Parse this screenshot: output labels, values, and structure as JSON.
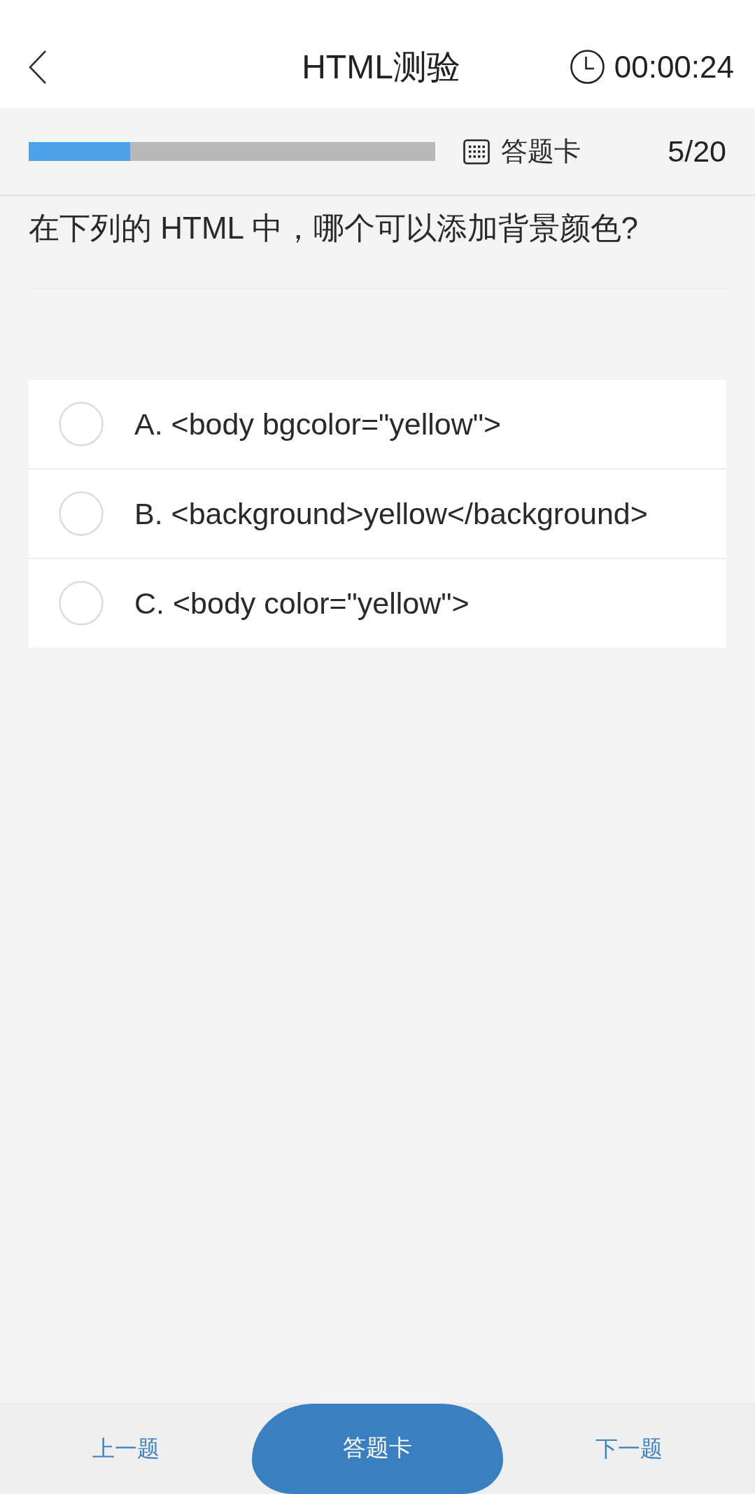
{
  "header": {
    "title": "HTML测验",
    "timer": "00:00:24"
  },
  "progress": {
    "level": 0.25,
    "answer_card_label": "答题卡",
    "counter": "5/20"
  },
  "question": {
    "text": "在下列的 HTML 中，哪个可以添加背景颜色?"
  },
  "options": [
    {
      "label": "A. <body bgcolor=\"yellow\">",
      "selected": false
    },
    {
      "label": "B. <background>yellow</background>",
      "selected": false
    },
    {
      "label": "C. <body color=\"yellow\">",
      "selected": false
    }
  ],
  "bottom_bar": {
    "buttons": [
      {
        "label": "上一题",
        "kind": "text"
      },
      {
        "label": "答题卡",
        "kind": "primary"
      },
      {
        "label": "下一题",
        "kind": "text"
      }
    ]
  }
}
